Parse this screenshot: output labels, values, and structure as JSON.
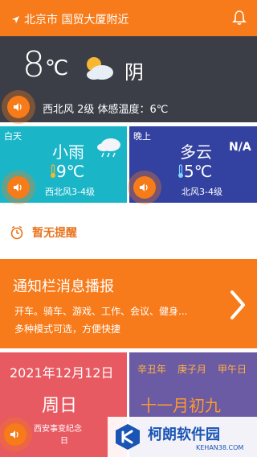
{
  "header": {
    "location": "北京市 国贸大厦附近"
  },
  "current": {
    "temp": "8",
    "unit": "℃",
    "condition": "阴",
    "wind_feel": "西北风 2级  体感温度：6℃"
  },
  "day": {
    "label": "白天",
    "condition": "小雨",
    "temp": "9℃",
    "wind": "西北风3-4级"
  },
  "night": {
    "label": "晚上",
    "condition": "多云",
    "aqi": "N/A",
    "temp": "5℃",
    "wind": "北风3-4级"
  },
  "reminder": {
    "text": "暂无提醒"
  },
  "notice": {
    "title": "通知栏消息播报",
    "line1": "开车。骑车、游戏、工作、会议、健身...",
    "line2": "多种模式可选，方便快捷"
  },
  "calendar": {
    "date": "2021年12月12日",
    "weekday": "周日",
    "event_line1": "西安事变纪念",
    "event_line2": "日",
    "ganzhi_year": "辛丑年",
    "ganzhi_month": "庚子月",
    "ganzhi_day": "甲午日",
    "lunar_date": "十一月初九"
  },
  "watermark": {
    "main": "柯朗软件园",
    "sub": "KEHAN38.COM"
  },
  "colors": {
    "accent": "#f77b1a",
    "day_bg": "#1ab6c8",
    "night_bg": "#3341a0",
    "date_bg": "#e85a62",
    "lunar_bg": "#6b5aa4"
  }
}
